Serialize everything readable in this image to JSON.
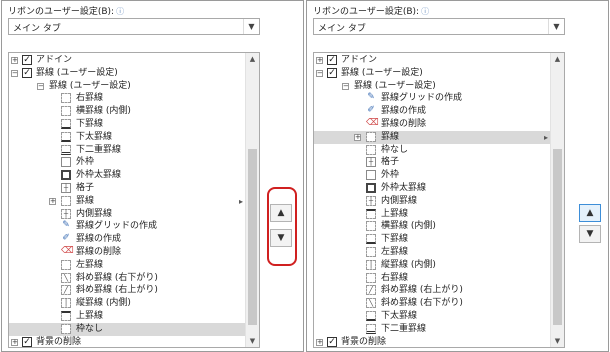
{
  "left": {
    "heading": "リボンのユーザー設定(B):",
    "info_icon": "info-circle-icon",
    "combo_value": "メイン タブ",
    "rows": [
      {
        "label": "アドイン",
        "level": 0,
        "expand": "+",
        "checked": true
      },
      {
        "label": "罫線 (ユーザー設定)",
        "level": 0,
        "expand": "-",
        "checked": true
      },
      {
        "label": "罫線 (ユーザー設定)",
        "level": 1,
        "expand": "-"
      },
      {
        "label": "右罫線",
        "level": 2,
        "icon": "right-border-icon"
      },
      {
        "label": "横罫線 (内側)",
        "level": 2,
        "icon": "inside-horizontal-border-icon"
      },
      {
        "label": "下罫線",
        "level": 2,
        "icon": "bottom-border-icon"
      },
      {
        "label": "下太罫線",
        "level": 2,
        "icon": "thick-bottom-border-icon"
      },
      {
        "label": "下二重罫線",
        "level": 2,
        "icon": "double-bottom-border-icon"
      },
      {
        "label": "外枠",
        "level": 2,
        "icon": "outside-borders-icon"
      },
      {
        "label": "外枠太罫線",
        "level": 2,
        "icon": "thick-outside-borders-icon"
      },
      {
        "label": "格子",
        "level": 2,
        "icon": "all-borders-icon"
      },
      {
        "label": "罫線",
        "level": 2,
        "expand": "+",
        "icon": "borders-icon",
        "submenu": true
      },
      {
        "label": "内側罫線",
        "level": 2,
        "icon": "inside-borders-icon"
      },
      {
        "label": "罫線グリッドの作成",
        "level": 2,
        "icon": "draw-border-grid-icon"
      },
      {
        "label": "罫線の作成",
        "level": 2,
        "icon": "draw-border-icon"
      },
      {
        "label": "罫線の削除",
        "level": 2,
        "icon": "erase-border-icon"
      },
      {
        "label": "左罫線",
        "level": 2,
        "icon": "left-border-icon"
      },
      {
        "label": "斜め罫線 (右下がり)",
        "level": 2,
        "icon": "diagonal-down-border-icon"
      },
      {
        "label": "斜め罫線 (右上がり)",
        "level": 2,
        "icon": "diagonal-up-border-icon"
      },
      {
        "label": "縦罫線 (内側)",
        "level": 2,
        "icon": "inside-vertical-border-icon"
      },
      {
        "label": "上罫線",
        "level": 2,
        "icon": "top-border-icon"
      },
      {
        "label": "枠なし",
        "level": 2,
        "icon": "no-border-icon",
        "selected": true
      },
      {
        "label": "背景の削除",
        "level": 0,
        "expand": "+",
        "checked": true
      }
    ],
    "move_up": "▲",
    "move_down": "▼"
  },
  "right": {
    "heading": "リボンのユーザー設定(B):",
    "info_icon": "info-circle-icon",
    "combo_value": "メイン タブ",
    "rows": [
      {
        "label": "アドイン",
        "level": 0,
        "expand": "+",
        "checked": true
      },
      {
        "label": "罫線 (ユーザー設定)",
        "level": 0,
        "expand": "-",
        "checked": true
      },
      {
        "label": "罫線 (ユーザー設定)",
        "level": 1,
        "expand": "-"
      },
      {
        "label": "罫線グリッドの作成",
        "level": 2,
        "icon": "draw-border-grid-icon"
      },
      {
        "label": "罫線の作成",
        "level": 2,
        "icon": "draw-border-icon"
      },
      {
        "label": "罫線の削除",
        "level": 2,
        "icon": "erase-border-icon"
      },
      {
        "label": "罫線",
        "level": 2,
        "expand": "+",
        "icon": "borders-icon",
        "submenu": true,
        "selected": true
      },
      {
        "label": "枠なし",
        "level": 2,
        "icon": "no-border-icon"
      },
      {
        "label": "格子",
        "level": 2,
        "icon": "all-borders-icon"
      },
      {
        "label": "外枠",
        "level": 2,
        "icon": "outside-borders-icon"
      },
      {
        "label": "外枠太罫線",
        "level": 2,
        "icon": "thick-outside-borders-icon"
      },
      {
        "label": "内側罫線",
        "level": 2,
        "icon": "inside-borders-icon"
      },
      {
        "label": "上罫線",
        "level": 2,
        "icon": "top-border-icon"
      },
      {
        "label": "横罫線 (内側)",
        "level": 2,
        "icon": "inside-horizontal-border-icon"
      },
      {
        "label": "下罫線",
        "level": 2,
        "icon": "bottom-border-icon"
      },
      {
        "label": "左罫線",
        "level": 2,
        "icon": "left-border-icon"
      },
      {
        "label": "縦罫線 (内側)",
        "level": 2,
        "icon": "inside-vertical-border-icon"
      },
      {
        "label": "右罫線",
        "level": 2,
        "icon": "right-border-icon"
      },
      {
        "label": "斜め罫線 (右上がり)",
        "level": 2,
        "icon": "diagonal-up-border-icon"
      },
      {
        "label": "斜め罫線 (右下がり)",
        "level": 2,
        "icon": "diagonal-down-border-icon"
      },
      {
        "label": "下太罫線",
        "level": 2,
        "icon": "thick-bottom-border-icon"
      },
      {
        "label": "下二重罫線",
        "level": 2,
        "icon": "double-bottom-border-icon"
      },
      {
        "label": "背景の削除",
        "level": 0,
        "expand": "+",
        "checked": true
      }
    ],
    "move_up": "▲",
    "move_down": "▼"
  },
  "colors": {
    "highlight": "#d02020",
    "selection": "#d9d9d9",
    "focus_border": "#3d8ed8"
  }
}
